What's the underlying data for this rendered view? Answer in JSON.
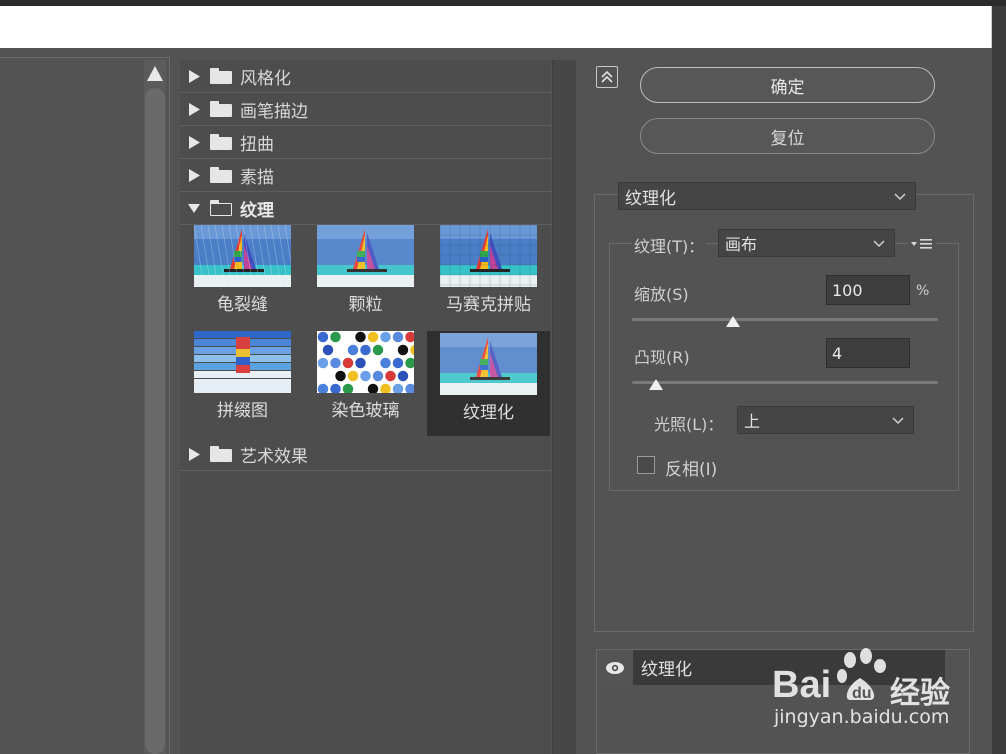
{
  "filter_groups_top": [
    {
      "label": "风格化"
    },
    {
      "label": "画笔描边"
    },
    {
      "label": "扭曲"
    },
    {
      "label": "素描"
    }
  ],
  "open_group": {
    "label": "纹理"
  },
  "thumbnails": [
    {
      "label": "龟裂缝",
      "selected": false
    },
    {
      "label": "颗粒",
      "selected": false
    },
    {
      "label": "马赛克拼贴",
      "selected": false
    },
    {
      "label": "拼缀图",
      "selected": false
    },
    {
      "label": "染色玻璃",
      "selected": false
    },
    {
      "label": "纹理化",
      "selected": true
    }
  ],
  "filter_groups_bottom": [
    {
      "label": "艺术效果"
    }
  ],
  "buttons": {
    "ok": "确定",
    "reset": "复位"
  },
  "filter_select": {
    "value": "纹理化"
  },
  "texture": {
    "label": "纹理(T)：",
    "value": "画布",
    "scaling": {
      "label": "缩放(S)",
      "value": "100",
      "unit": "%",
      "slider_fraction": 0.33
    },
    "relief": {
      "label": "凸现(R)",
      "value": "4",
      "slider_fraction": 0.08
    },
    "light": {
      "label": "光照(L)：",
      "value": "上"
    },
    "invert": {
      "label": "反相(I)",
      "checked": false
    }
  },
  "layers": [
    {
      "label": "纹理化",
      "visible": true
    }
  ],
  "watermark": {
    "brand": "Bai",
    "brand_suffix": "经验",
    "url": "jingyan.baidu.com"
  },
  "colors": {
    "panel": "#535353",
    "list": "#4d4d4d",
    "selected": "#303030",
    "text": "#d6d6d6"
  }
}
